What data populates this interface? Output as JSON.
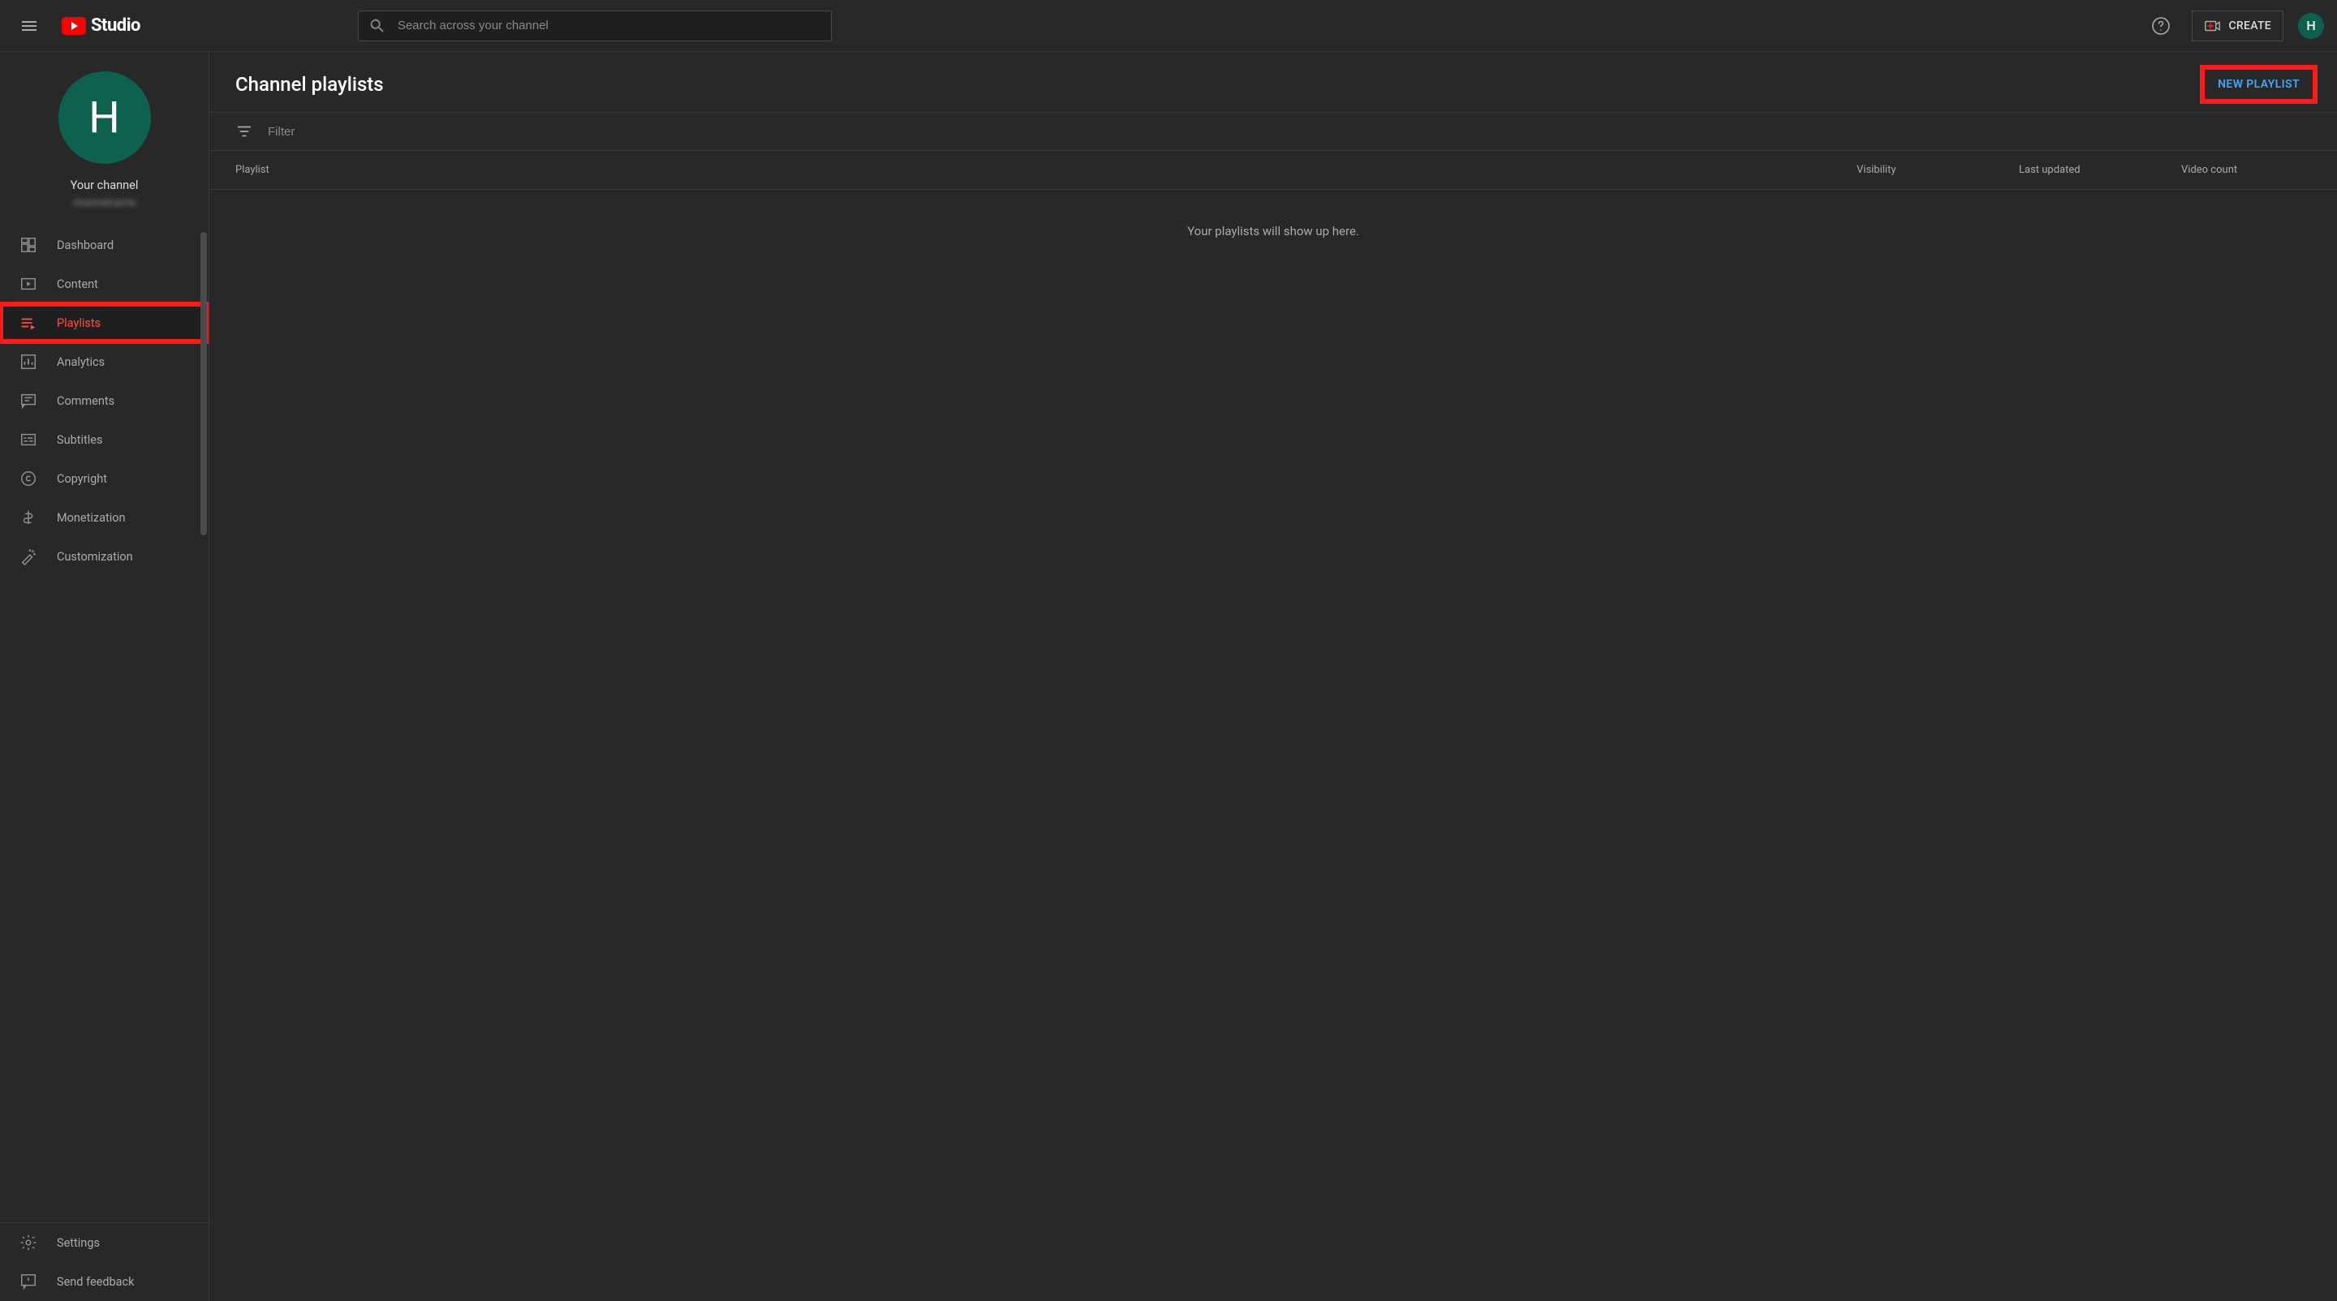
{
  "header": {
    "brand": "Studio",
    "search_placeholder": "Search across your channel",
    "create_label": "CREATE",
    "avatar_initial": "H"
  },
  "sidebar": {
    "avatar_initial": "H",
    "your_channel_label": "Your channel",
    "channel_name": "channelname",
    "nav": [
      {
        "label": "Dashboard"
      },
      {
        "label": "Content"
      },
      {
        "label": "Playlists"
      },
      {
        "label": "Analytics"
      },
      {
        "label": "Comments"
      },
      {
        "label": "Subtitles"
      },
      {
        "label": "Copyright"
      },
      {
        "label": "Monetization"
      },
      {
        "label": "Customization"
      }
    ],
    "footer": [
      {
        "label": "Settings"
      },
      {
        "label": "Send feedback"
      }
    ]
  },
  "main": {
    "page_title": "Channel playlists",
    "new_playlist_label": "NEW PLAYLIST",
    "filter_placeholder": "Filter",
    "columns": {
      "playlist": "Playlist",
      "visibility": "Visibility",
      "last_updated": "Last updated",
      "video_count": "Video count"
    },
    "empty_message": "Your playlists will show up here."
  }
}
